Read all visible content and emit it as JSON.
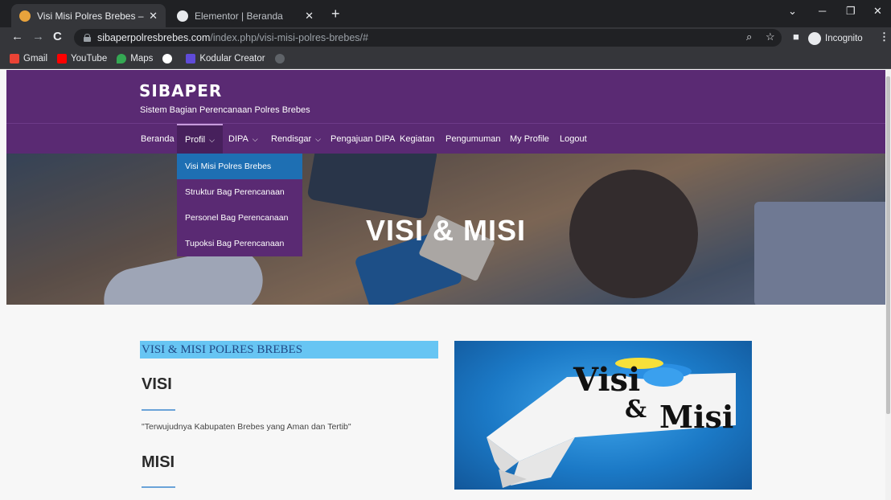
{
  "browser": {
    "tabs": [
      {
        "title": "Visi Misi Polres Brebes – Sibaper",
        "active": true
      },
      {
        "title": "Elementor | Beranda",
        "active": false
      }
    ],
    "address": {
      "host": "sibaperpolresbrebes.com",
      "path": "/index.php/visi-misi-polres-brebes/#"
    },
    "incognito_label": "Incognito",
    "bookmarks": [
      "Gmail",
      "YouTube",
      "Maps",
      "Kodular Creator"
    ]
  },
  "site": {
    "logo": "SIBAPER",
    "tagline": "Sistem Bagian Perencanaan Polres Brebes",
    "menu": [
      "Beranda",
      "Profil",
      "DIPA",
      "Rendisgar",
      "Pengajuan DIPA",
      "Kegiatan",
      "Pengumuman",
      "My Profile",
      "Logout"
    ],
    "dropdown": [
      "Visi Misi Polres Brebes",
      "Struktur Bag Perencanaan",
      "Personel Bag Perencanaan",
      "Tupoksi Bag Perencanaan"
    ],
    "hero_title": "VISI & MISI"
  },
  "content": {
    "section_title": "VISI & MISI POLRES BREBES",
    "visi_heading": "VISI",
    "visi_text": "\"Terwujudnya Kabupaten Brebes yang Aman dan Tertib\"",
    "misi_heading": "MISI",
    "image_text_1": "Visi",
    "image_text_2": "&",
    "image_text_3": "Misi"
  },
  "colors": {
    "brand": "#5a2a73",
    "dropdown_active": "#1e6fb3",
    "title_highlight": "#67c5f3"
  }
}
